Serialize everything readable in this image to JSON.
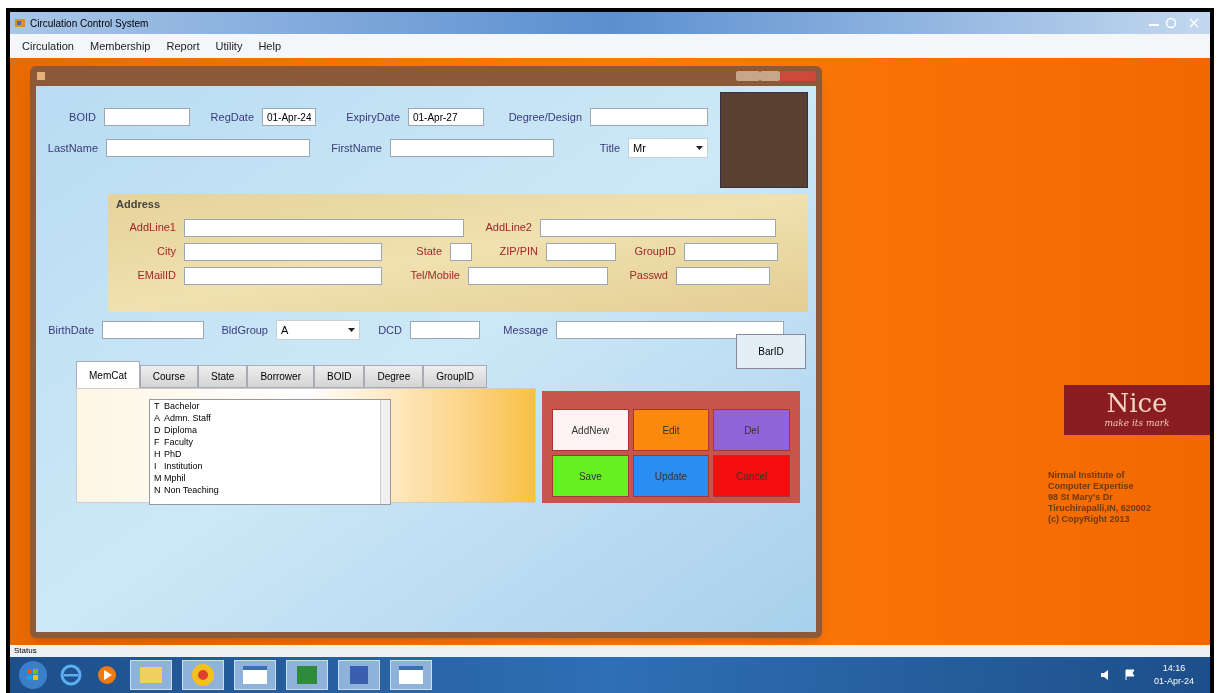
{
  "window": {
    "title": "Circulation Control System"
  },
  "menu": [
    "Circulation",
    "Membership",
    "Report",
    "Utility",
    "Help"
  ],
  "form": {
    "row1": [
      {
        "label": "BOID"
      },
      {
        "label": "RegDate",
        "value": "01-Apr-24"
      },
      {
        "label": "ExpiryDate",
        "value": "01-Apr-27"
      },
      {
        "label": "Degree/Design"
      }
    ],
    "row2": [
      {
        "label": "LastName"
      },
      {
        "label": "FirstName"
      }
    ],
    "title_field": {
      "label": "Title",
      "value": "Mr"
    },
    "address": {
      "title": "Address",
      "fields": [
        {
          "label": "AddLine1"
        },
        {
          "label": "AddLine2"
        },
        {
          "label": "City"
        },
        {
          "label": "State"
        },
        {
          "label": "ZIP/PIN"
        },
        {
          "label": "GroupID"
        },
        {
          "label": "EMailID"
        },
        {
          "label": "Tel/Mobile"
        },
        {
          "label": "Passwd"
        }
      ]
    },
    "birth_date": {
      "label": "BirthDate"
    },
    "blood_group": {
      "label": "BldGroup",
      "value": "A"
    },
    "dcd": {
      "label": "DCD"
    },
    "message": {
      "label": "Message"
    },
    "tabs": [
      {
        "label": "MemCat",
        "selected": true
      },
      {
        "label": "Course",
        "selected": false
      },
      {
        "label": "State",
        "selected": false
      },
      {
        "label": "Borrower",
        "selected": false
      },
      {
        "label": "BOID",
        "selected": false
      },
      {
        "label": "Degree",
        "selected": false
      },
      {
        "label": "GroupID",
        "selected": false
      }
    ],
    "barid_button": "BarID",
    "list": [
      {
        "code": "T",
        "name": "Bachelor"
      },
      {
        "code": "A",
        "name": "Admn. Staff"
      },
      {
        "code": "D",
        "name": "Diploma"
      },
      {
        "code": "F",
        "name": "Faculty"
      },
      {
        "code": "H",
        "name": "PhD"
      },
      {
        "code": "I",
        "name": "Institution"
      },
      {
        "code": "M",
        "name": "Mphil"
      },
      {
        "code": "N",
        "name": "Non Teaching"
      }
    ],
    "actions": [
      {
        "label": "AddNew",
        "color": "#fdf3f3"
      },
      {
        "label": "Edit",
        "color": "#fb8a0a"
      },
      {
        "label": "Del",
        "color": "#9163d9"
      },
      {
        "label": "Save",
        "color": "#66f020"
      },
      {
        "label": "Update",
        "color": "#2b8cf2"
      },
      {
        "label": "Cancel",
        "color": "#f50d0d"
      }
    ]
  },
  "brand": {
    "logo": "Nice",
    "tagline": "make its mark",
    "address": [
      "Nirmal Institute of",
      "Computer Expertise",
      "98 St Mary's Dr",
      "Tiruchirapalli,IN, 620002",
      "(c) CopyRight 2013"
    ]
  },
  "status_bar": "Status",
  "taskbar": {
    "time": "14:16",
    "date": "01-Apr-24"
  }
}
